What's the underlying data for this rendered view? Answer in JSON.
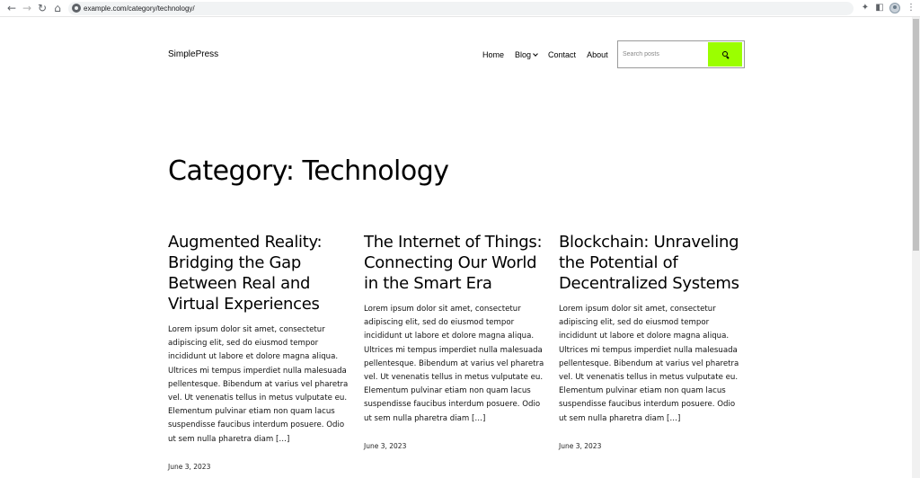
{
  "browser": {
    "url": "example.com/category/technology/"
  },
  "site": {
    "title": "SimplePress"
  },
  "nav": {
    "items": [
      {
        "label": "Home"
      },
      {
        "label": "Blog",
        "has_dropdown": true
      },
      {
        "label": "Contact"
      },
      {
        "label": "About"
      }
    ]
  },
  "search": {
    "placeholder": "Search posts",
    "button_color": "#9bff00"
  },
  "page": {
    "title": "Category: Technology"
  },
  "posts": [
    {
      "title": "Augmented Reality: Bridging the Gap Between Real and Virtual Experiences",
      "excerpt": "Lorem ipsum dolor sit amet, consectetur adipiscing elit, sed do eiusmod tempor incididunt ut labore et dolore magna aliqua. Ultrices mi tempus imperdiet nulla malesuada pellentesque. Bibendum at varius vel pharetra vel. Ut venenatis tellus in metus vulputate eu. Elementum pulvinar etiam non quam lacus suspendisse faucibus interdum posuere. Odio ut sem nulla pharetra diam […]",
      "date": "June 3, 2023"
    },
    {
      "title": "The Internet of Things: Connecting Our World in the Smart Era",
      "excerpt": "Lorem ipsum dolor sit amet, consectetur adipiscing elit, sed do eiusmod tempor incididunt ut labore et dolore magna aliqua. Ultrices mi tempus imperdiet nulla malesuada pellentesque. Bibendum at varius vel pharetra vel. Ut venenatis tellus in metus vulputate eu. Elementum pulvinar etiam non quam lacus suspendisse faucibus interdum posuere. Odio ut sem nulla pharetra diam […]",
      "date": "June 3, 2023"
    },
    {
      "title": "Blockchain: Unraveling the Potential of Decentralized Systems",
      "excerpt": "Lorem ipsum dolor sit amet, consectetur adipiscing elit, sed do eiusmod tempor incididunt ut labore et dolore magna aliqua. Ultrices mi tempus imperdiet nulla malesuada pellentesque. Bibendum at varius vel pharetra vel. Ut venenatis tellus in metus vulputate eu. Elementum pulvinar etiam non quam lacus suspendisse faucibus interdum posuere. Odio ut sem nulla pharetra diam […]",
      "date": "June 3, 2023"
    }
  ]
}
